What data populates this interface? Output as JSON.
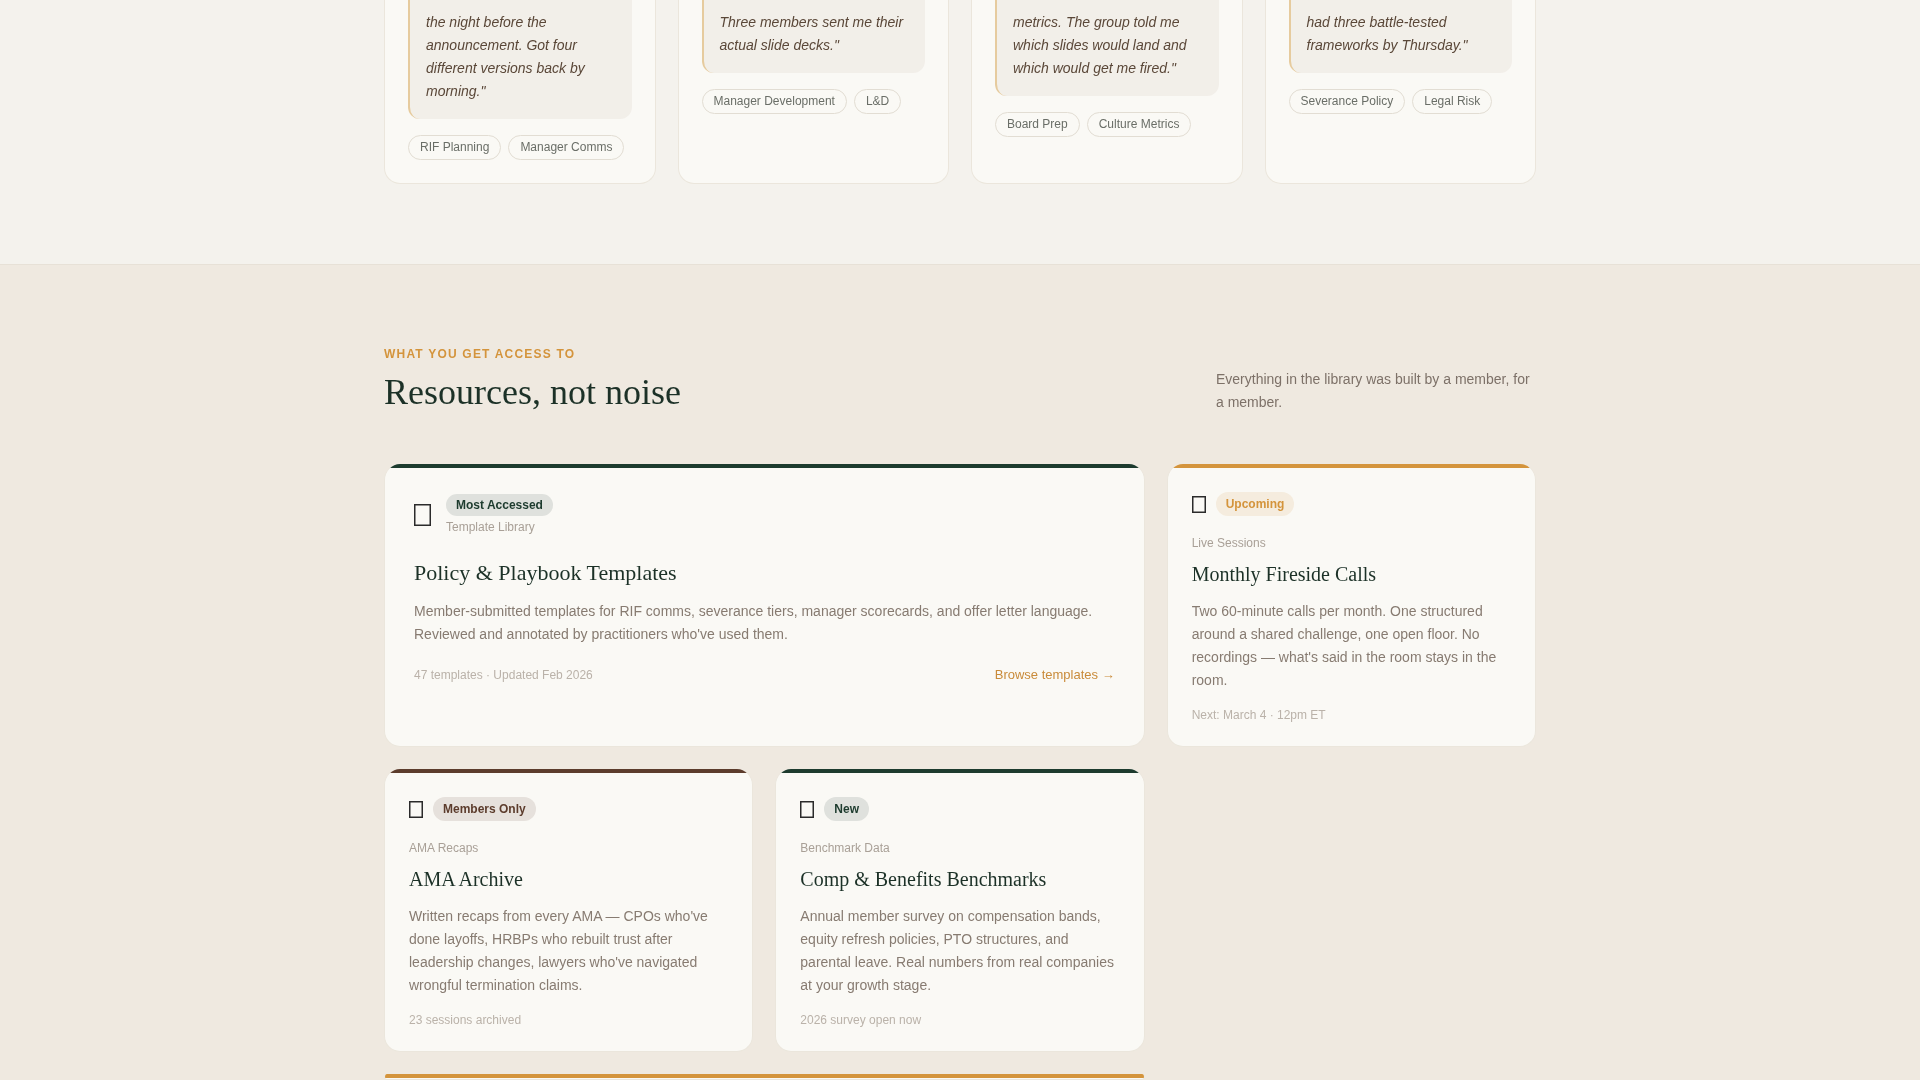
{
  "testimonials": [
    {
      "quote": "the night before the announcement. Got four different versions back by morning.\"",
      "tags": [
        "RIF Planning",
        "Manager Comms"
      ]
    },
    {
      "quote": "Three members sent me their actual slide decks.\"",
      "tags": [
        "Manager Development",
        "L&D"
      ]
    },
    {
      "quote": "metrics. The group told me which slides would land and which would get me fired.\"",
      "tags": [
        "Board Prep",
        "Culture Metrics"
      ]
    },
    {
      "quote": "had three battle-tested frameworks by Thursday.\"",
      "tags": [
        "Severance Policy",
        "Legal Risk"
      ]
    }
  ],
  "resources": {
    "eyebrow": "WHAT YOU GET ACCESS TO",
    "title": "Resources, not noise",
    "intro": "Everything in the library was built by a member, for a member.",
    "cards": [
      {
        "kind": "featured",
        "color": "#1d3b2e",
        "badge": "Most Accessed",
        "category": "Template Library",
        "title": "Policy & Playbook Templates",
        "description": "Member-submitted templates for RIF comms, severance tiers, manager scorecards, and offer letter language. Reviewed and annotated by practitioners who've used them.",
        "meta": "47 templates · Updated Feb 2026",
        "link": "Browse templates →"
      },
      {
        "kind": "standard",
        "color": "#d4943c",
        "badge": "Upcoming",
        "category": "Live Sessions",
        "title": "Monthly Fireside Calls",
        "description": "Two 60-minute calls per month. One structured around a shared challenge, one open floor. No recordings — what's said in the room stays in the room.",
        "meta": "Next: March 4 · 12pm ET"
      },
      {
        "kind": "standard",
        "color": "#5c3c2c",
        "badge": "Members Only",
        "category": "AMA Recaps",
        "title": "AMA Archive",
        "description": "Written recaps from every AMA — CPOs who've done layoffs, HRBPs who rebuilt trust after leadership changes, lawyers who've navigated wrongful termination claims.",
        "meta": "23 sessions archived"
      },
      {
        "kind": "standard",
        "color": "#1d3b2e",
        "badge": "New",
        "category": "Benchmark Data",
        "title": "Comp & Benefits Benchmarks",
        "description": "Annual member survey on compensation bands, equity refresh policies, PTO structures, and parental leave. Real numbers from real companies at your growth stage.",
        "meta": "2026 survey open now"
      },
      {
        "kind": "featured",
        "color": "#d4943c"
      }
    ]
  }
}
